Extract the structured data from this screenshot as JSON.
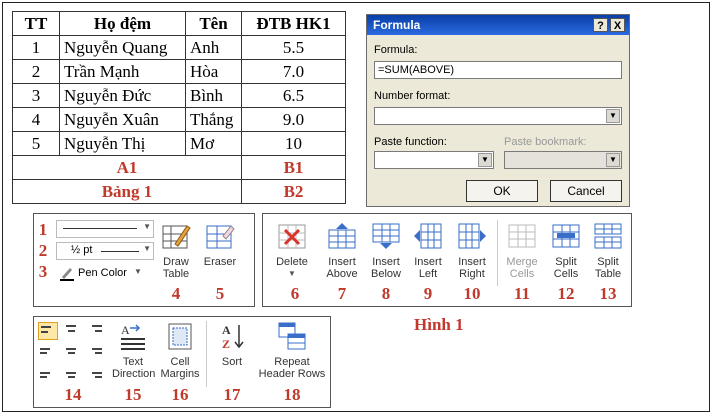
{
  "table": {
    "headers": [
      "TT",
      "Họ đệm",
      "Tên",
      "ĐTB HK1"
    ],
    "rows": [
      [
        "1",
        "Nguyễn Quang",
        "Anh",
        "5.5"
      ],
      [
        "2",
        "Trần Mạnh",
        "Hòa",
        "7.0"
      ],
      [
        "3",
        "Nguyễn Đức",
        "Bình",
        "6.5"
      ],
      [
        "4",
        "Nguyễn Xuân",
        "Thắng",
        "9.0"
      ],
      [
        "5",
        "Nguyễn Thị",
        "Mơ",
        "10"
      ]
    ],
    "a1": "A1",
    "b1": "B1",
    "caption": "Bảng 1",
    "b2": "B2"
  },
  "dialog": {
    "title": "Formula",
    "help": "?",
    "close": "X",
    "formula_label": "Formula:",
    "formula_value": "=SUM(ABOVE)",
    "number_format_label": "Number format:",
    "paste_function_label": "Paste function:",
    "paste_bookmark_label": "Paste bookmark:",
    "ok": "OK",
    "cancel": "Cancel"
  },
  "borders": {
    "line_width": "½ pt",
    "pen_color": "Pen Color",
    "draw_table": "Draw Table",
    "eraser": "Eraser",
    "row_numbers": [
      "1",
      "2",
      "3"
    ],
    "num_draw": "4",
    "num_eraser": "5"
  },
  "rowscols": {
    "items": [
      {
        "label": "Delete",
        "num": "6"
      },
      {
        "label": "Insert Above",
        "num": "7"
      },
      {
        "label": "Insert Below",
        "num": "8"
      },
      {
        "label": "Insert Left",
        "num": "9"
      },
      {
        "label": "Insert Right",
        "num": "10"
      },
      {
        "label": "Merge Cells",
        "num": "11"
      },
      {
        "label": "Split Cells",
        "num": "12"
      },
      {
        "label": "Split Table",
        "num": "13"
      }
    ]
  },
  "hinh": "Hình 1",
  "align": {
    "items": [
      {
        "label": "",
        "num": "14"
      },
      {
        "label": "Text Direction",
        "num": "15"
      },
      {
        "label": "Cell Margins",
        "num": "16"
      },
      {
        "label": "Sort",
        "num": "17"
      },
      {
        "label": "Repeat Header Rows",
        "num": "18"
      }
    ]
  },
  "colors": {
    "red": "#c0392b",
    "dialog_title": "#0a3fa6",
    "accent_icon": "#3a6ec8"
  }
}
